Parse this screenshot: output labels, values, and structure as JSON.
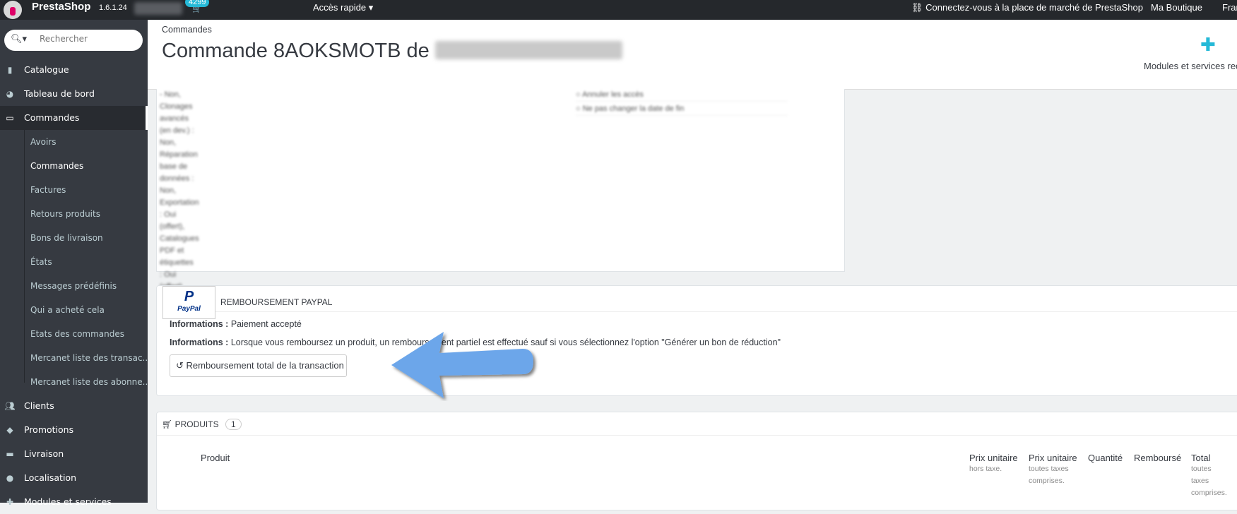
{
  "topbar": {
    "brand": "PrestaShop",
    "version": "1.6.1.24",
    "cart_badge": "4299",
    "quick_access": "Accès rapide",
    "marketplace": "Connectez-vous à la place de marché de PrestaShop",
    "shop": "Ma Boutique",
    "language": "Fran"
  },
  "sidebar": {
    "search_placeholder": "Rechercher",
    "items": [
      {
        "label": "Catalogue",
        "icon": "book-icon"
      },
      {
        "label": "Tableau de bord",
        "icon": "dashboard-icon"
      },
      {
        "label": "Commandes",
        "icon": "credit-card-icon",
        "active": true
      },
      {
        "label": "Clients",
        "icon": "users-icon"
      },
      {
        "label": "Promotions",
        "icon": "tags-icon"
      },
      {
        "label": "Livraison",
        "icon": "truck-icon"
      },
      {
        "label": "Localisation",
        "icon": "globe-icon"
      },
      {
        "label": "Modules et services",
        "icon": "puzzle-icon"
      }
    ],
    "sub_items": [
      "Avoirs",
      "Commandes",
      "Factures",
      "Retours produits",
      "Bons de livraison",
      "États",
      "Messages prédéfinis",
      "Qui a acheté cela",
      "Etats des commandes",
      "Mercanet liste des transac...",
      "Mercanet liste des abonne..."
    ]
  },
  "header": {
    "breadcrumb": "Commandes",
    "title": "Commande 8AOKSMOTB de",
    "modules_label": "Modules et services rec",
    "accent": "#25b9d7"
  },
  "paypal": {
    "logo_text": "PayPal",
    "title": "REMBOURSEMENT PAYPAL",
    "info_label": "Informations :",
    "info1": "Paiement accepté",
    "info2": "Lorsque vous remboursez un produit, un remboursement partiel est effectué sauf si vous sélectionnez l'option \"Générer un bon de réduction\"",
    "refund_button": "Remboursement total de la transaction",
    "arrow_color": "#6ca6ea"
  },
  "products": {
    "title": "PRODUITS",
    "count": "1",
    "columns": [
      {
        "label": "Produit",
        "sub": ""
      },
      {
        "label": "Prix unitaire",
        "sub": "hors taxe."
      },
      {
        "label": "Prix unitaire",
        "sub": "toutes taxes comprises."
      },
      {
        "label": "Quantité",
        "sub": ""
      },
      {
        "label": "Remboursé",
        "sub": ""
      },
      {
        "label": "Total",
        "sub": "toutes taxes comprises."
      }
    ]
  }
}
